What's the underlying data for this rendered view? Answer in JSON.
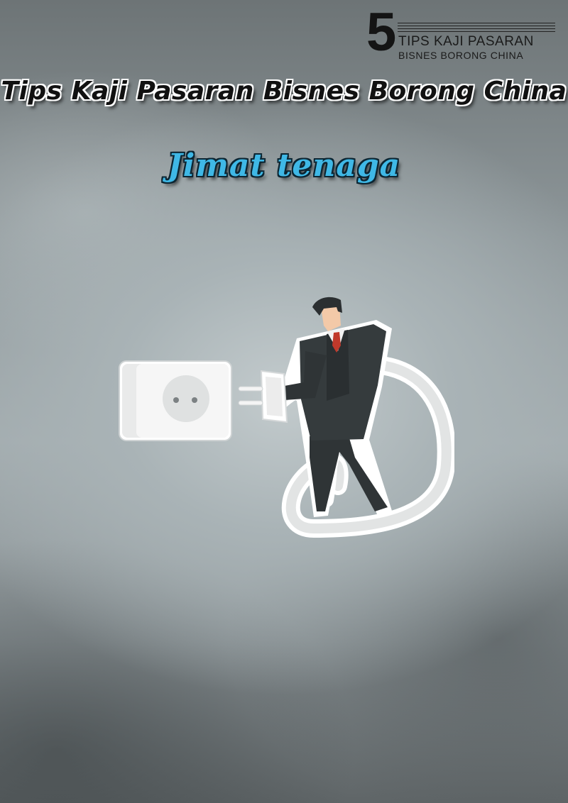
{
  "logo": {
    "number": "5",
    "line1": "TIPS KAJI PASARAN",
    "line2": "BISNES BORONG CHINA"
  },
  "header": {
    "title": "Tips Kaji Pasaran Bisnes Borong China",
    "subtitle": "Jimat tenaga"
  },
  "illustration": {
    "icon": "businessman-unplugging-plug-from-socket-icon"
  },
  "colors": {
    "subtitle": "#3fb8e6",
    "suit": "#2f3436",
    "tie": "#c0392b",
    "cable": "#eeeeee"
  }
}
